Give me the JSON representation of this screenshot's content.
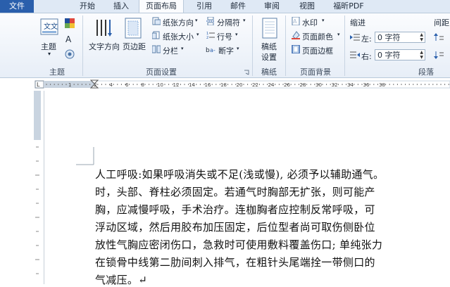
{
  "tabs": [
    {
      "label": "文件"
    },
    {
      "label": "开始"
    },
    {
      "label": "插入"
    },
    {
      "label": "页面布局"
    },
    {
      "label": "引用"
    },
    {
      "label": "邮件"
    },
    {
      "label": "审阅"
    },
    {
      "label": "视图"
    },
    {
      "label": "福昕PDF"
    }
  ],
  "ribbon": {
    "theme": {
      "label": "主题",
      "group": "主题"
    },
    "text_direction": "文字方向",
    "margins": "页边距",
    "orientation": "纸张方向",
    "size": "纸张大小",
    "columns": "分栏",
    "breaks": "分隔符",
    "line_numbers": "行号",
    "hyphenation": "断字",
    "page_setup_group": "页面设置",
    "manuscript": {
      "line1": "稿纸",
      "line2": "设置",
      "group": "稿纸"
    },
    "watermark": "水印",
    "page_color": "页面颜色",
    "page_borders": "页面边框",
    "page_background_group": "页面背景",
    "indent": {
      "title": "缩进",
      "left_label": "左:",
      "left_value": "0 字符",
      "right_label": "右:",
      "right_value": "0 字符"
    },
    "spacing_title": "间距",
    "paragraph_group": "段落"
  },
  "document": {
    "lines": [
      "人工呼吸:如果呼吸消失或不足(浅或慢), 必须予以辅助通气。",
      "时，头部、脊柱必须固定。若通气时胸部无扩张，则可能产",
      "胸，应减慢呼吸，手术治疗。连枷胸者应控制反常呼吸，可",
      "浮动区域，然后用胶布加压固定，后位型者尚可取伤侧卧位",
      "放性气胸应密闭伤口，急救时可使用敷料覆盖伤口; 单纯张力",
      "在锁骨中线第二肋间刺入排气，在粗针头尾端拴一带侧口的",
      "气减压。↵"
    ]
  },
  "ruler_numbers": [
    "1",
    "2",
    "4",
    "6",
    "8",
    "10",
    "12",
    "14",
    "16",
    "18",
    "20",
    "22",
    "24",
    "26",
    "28",
    "30",
    "32",
    "34",
    "36",
    "38"
  ],
  "colors": {
    "file_tab": "#2a5fac",
    "ribbon_bg": "#e7eef7",
    "accent": "#2a5fac"
  }
}
